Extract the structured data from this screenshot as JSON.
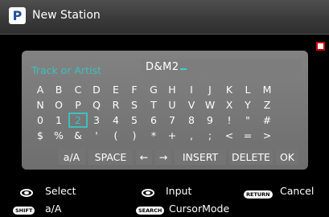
{
  "header": {
    "logo_letter": "P",
    "title": "New Station"
  },
  "field": {
    "label": "Track or Artist",
    "value": "D&M2"
  },
  "keyboard": {
    "rows": [
      [
        "A",
        "B",
        "C",
        "D",
        "E",
        "F",
        "G",
        "H",
        "I",
        "J",
        "K",
        "L",
        "M"
      ],
      [
        "N",
        "O",
        "P",
        "Q",
        "R",
        "S",
        "T",
        "U",
        "V",
        "W",
        "X",
        "Y",
        "Z"
      ],
      [
        "0",
        "1",
        "2",
        "3",
        "4",
        "5",
        "6",
        "7",
        "8",
        "9",
        "!",
        "\"",
        "#"
      ],
      [
        "$",
        "%",
        "&",
        "'",
        "(",
        ")",
        "*",
        "+",
        ",",
        ";",
        "<",
        "=",
        ">"
      ]
    ],
    "selected_key": "2",
    "function_keys": [
      "a/A",
      "SPACE",
      "←",
      "→",
      "INSERT",
      "DELETE",
      "OK"
    ]
  },
  "footer": {
    "select_label": "Select",
    "input_label": "Input",
    "return_badge": "RETURN",
    "cancel_label": "Cancel",
    "shift_badge": "SHIFT",
    "shift_label": "a/A",
    "search_badge": "SEARCH",
    "search_label": "CursorMode"
  },
  "colors": {
    "accent": "#3fbfbf",
    "indicator": "#d40000"
  }
}
